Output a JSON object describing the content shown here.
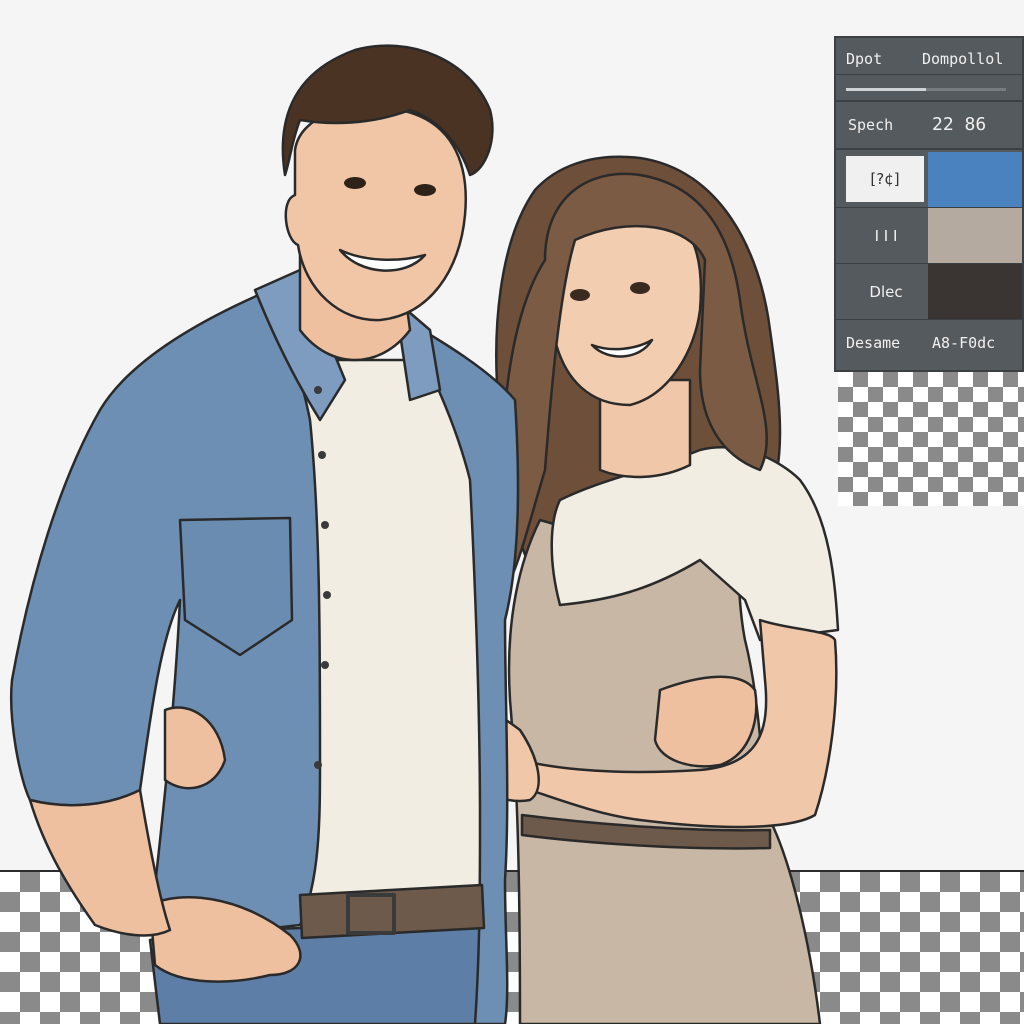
{
  "panel": {
    "header_left": "Dpot",
    "header_right": "Dompollol",
    "slider_value": 0.5,
    "spec_label": "Spech",
    "spec_value": "22 86",
    "swatches": [
      {
        "label": "[?¢]",
        "color": "#4a82bf"
      },
      {
        "label": "I I I",
        "color": "#b5aaa0"
      },
      {
        "label": "Dlec",
        "color": "#3a3433"
      }
    ],
    "footer_label": "Desame",
    "footer_value": "A8-F0dc"
  },
  "colors": {
    "shirt_denim": "#6d8fb4",
    "tshirt": "#f1ede3",
    "dress": "#c7b5a2",
    "hair_man": "#4b3323",
    "hair_woman": "#7a5a42",
    "skin": "#f0c4a4",
    "jeans": "#5d7ea6",
    "belt": "#6e5a4b"
  }
}
